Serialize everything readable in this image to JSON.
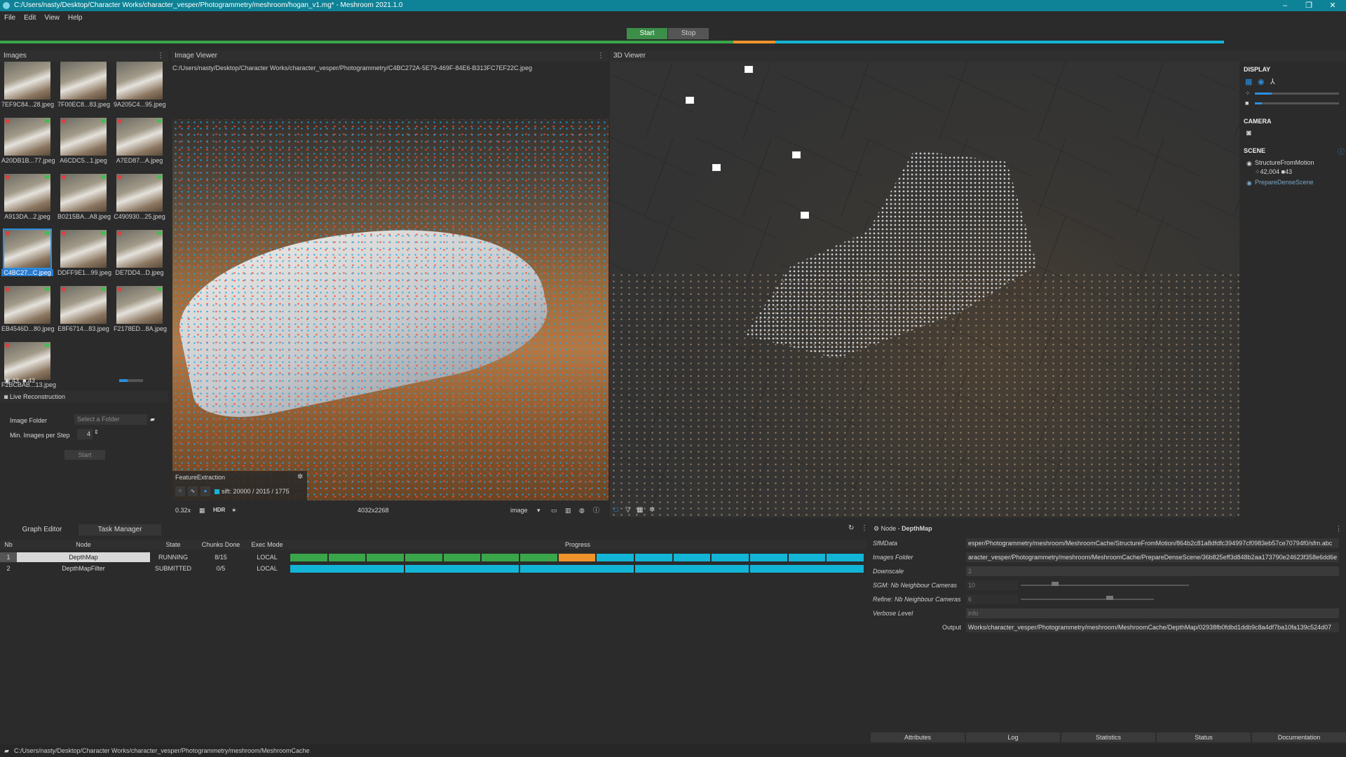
{
  "window": {
    "title": "C:/Users/nasty/Desktop/Character Works/character_vesper/Photogrammetry/meshroom/hogan_v1.mg* - Meshroom 2021.1.0"
  },
  "menu": [
    "File",
    "Edit",
    "View",
    "Help"
  ],
  "toolbar": {
    "start_label": "Start",
    "stop_label": "Stop"
  },
  "images_panel": {
    "title": "Images",
    "thumbnails": [
      "7EF9C84...28.jpeg",
      "7F00EC8...83.jpeg",
      "9A205C4...95.jpeg",
      "A20DB1B...77.jpeg",
      "A6CDC5...1.jpeg",
      "A7ED87...A.jpeg",
      "A913DA...2.jpeg",
      "B0215BA...A8.jpeg",
      "C490930...25.jpeg",
      "C4BC27...C.jpeg",
      "DDFF9E1...99.jpeg",
      "DE7DD4...D.jpeg",
      "EB4546D...80.jpeg",
      "E8F6714...83.jpeg",
      "F2178ED...8A.jpeg",
      "F2BCBAB...13.jpeg"
    ],
    "image_count": "43",
    "camera_count": "43",
    "live_reconstruction_label": "Live Reconstruction",
    "image_folder_label": "Image Folder",
    "image_folder_placeholder": "Select a Folder",
    "min_images_label": "Min. Images per Step",
    "min_images_value": "4",
    "start_label": "Start"
  },
  "image_viewer": {
    "title": "Image Viewer",
    "path": "C:/Users/nasty/Desktop/Character Works/character_vesper/Photogrammetry/C4BC272A-5E79-469F-84E6-B313FC7EF22C.jpeg",
    "overlay_title": "FeatureExtraction",
    "features_text": "sift: 20000 / 2015 / 1775",
    "zoom": "0.32x",
    "hdr_label": "HDR",
    "resolution": "4032x2268",
    "mode": "image"
  },
  "viewer3d": {
    "title": "3D Viewer",
    "display_label": "DISPLAY",
    "camera_label": "CAMERA",
    "scene_label": "SCENE",
    "scene_item_1": "StructureFromMotion",
    "scene_item_1_points": "42,004",
    "scene_item_1_cams": "43",
    "scene_item_2": "PrepareDenseScene"
  },
  "bottom_tabs": {
    "graph_editor": "Graph Editor",
    "task_manager": "Task Manager"
  },
  "task_table": {
    "headers": [
      "Nb",
      "Node",
      "State",
      "Chunks Done",
      "Exec Mode",
      "Progress"
    ],
    "rows": [
      {
        "nb": "1",
        "node": "DepthMap",
        "state": "RUNNING",
        "chunks": "8/15",
        "mode": "LOCAL"
      },
      {
        "nb": "2",
        "node": "DepthMapFilter",
        "state": "SUBMITTED",
        "chunks": "0/5",
        "mode": "LOCAL"
      }
    ],
    "colors": {
      "done": "#3aa64a",
      "running": "#f0932b",
      "submitted": "#12b5d6"
    }
  },
  "node_panel": {
    "title_prefix": "Node - ",
    "title": "DepthMap",
    "attributes": [
      {
        "label": "SfMData",
        "value": "esper/Photogrammetry/meshroom/MeshroomCache/StructureFromMotion/864b2c81a8dfdfc394997cf0983eb57ce70794f0/sfm.abc"
      },
      {
        "label": "Images Folder",
        "value": "aracter_vesper/Photogrammetry/meshroom/MeshroomCache/PrepareDenseScene/36b825eff3d848b2aa173790e24623f358e6dd6e"
      },
      {
        "label": "Downscale",
        "value": "2"
      },
      {
        "label": "SGM: Nb Neighbour Cameras",
        "value": "10"
      },
      {
        "label": "Refine: Nb Neighbour Cameras",
        "value": "6"
      },
      {
        "label": "Verbose Level",
        "value": "info"
      },
      {
        "label": "Output",
        "value": "Works/character_vesper/Photogrammetry/meshroom/MeshroomCache/DepthMap/02938fb0fdbd1ddb9c8a4df7ba10fa139c524d07"
      }
    ],
    "tabs": [
      "Attributes",
      "Log",
      "Statistics",
      "Status",
      "Documentation"
    ]
  },
  "status_bar": {
    "path": "C:/Users/nasty/Desktop/Character Works/character_vesper/Photogrammetry/meshroom/MeshroomCache"
  },
  "colors": {
    "accent": "#0e8296",
    "selection": "#2a7bcf",
    "green": "#3aa64a"
  }
}
